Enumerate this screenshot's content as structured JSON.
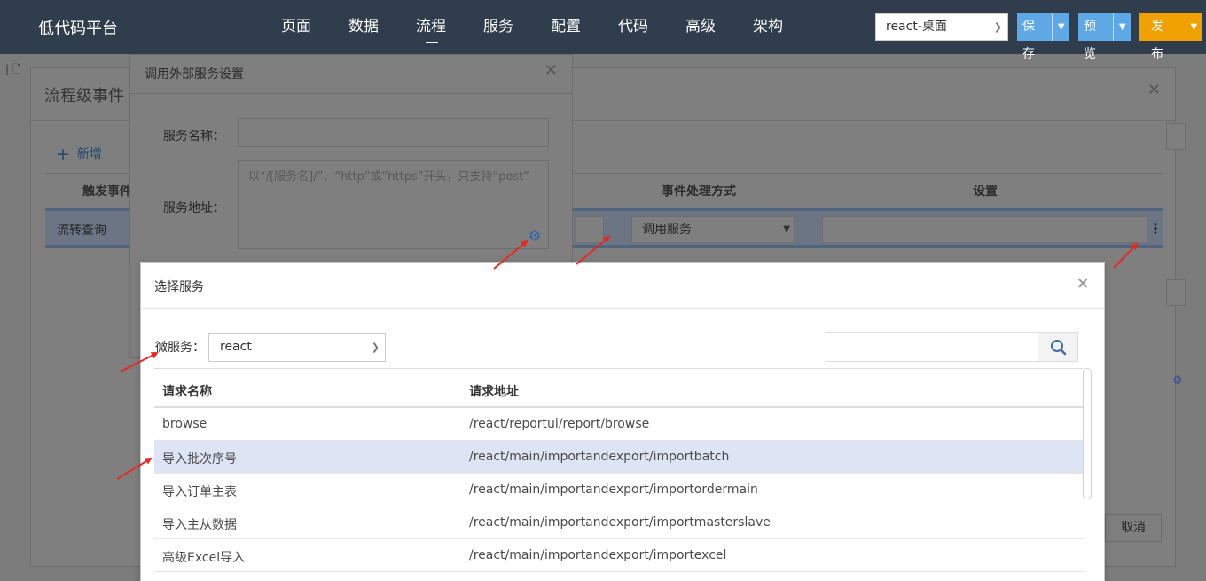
{
  "header": {
    "brand": "低代码平台",
    "nav": [
      "页面",
      "数据",
      "流程",
      "服务",
      "配置",
      "代码",
      "高级",
      "架构"
    ],
    "active_nav": "流程",
    "app_select": "react-桌面",
    "save_label": "保存",
    "preview_label": "预览",
    "publish_label": "发布"
  },
  "flow_dialog": {
    "title": "流程级事件",
    "add_label": "新增",
    "col_trigger": "触发事件",
    "col_method": "事件处理方式",
    "col_settings": "设置",
    "row_trigger": "流转查询",
    "row_method": "调用服务",
    "cancel_label": "取消"
  },
  "ext_dialog": {
    "title": "调用外部服务设置",
    "service_name_label": "服务名称：",
    "service_addr_label": "服务地址：",
    "service_addr_placeholder": "以“/[服务名]/”、“http”或“https”开头，只支持“post”"
  },
  "service_dialog": {
    "title": "选择服务",
    "microservice_label": "微服务：",
    "microservice_value": "react",
    "columns": [
      "请求名称",
      "请求地址"
    ],
    "rows": [
      {
        "name": "browse",
        "url": "/react/reportui/report/browse"
      },
      {
        "name": "导入批次序号",
        "url": "/react/main/importandexport/importbatch"
      },
      {
        "name": "导入订单主表",
        "url": "/react/main/importandexport/importordermain"
      },
      {
        "name": "导入主从数据",
        "url": "/react/main/importandexport/importmasterslave"
      },
      {
        "name": "高级Excel导入",
        "url": "/react/main/importandexport/importexcel"
      }
    ],
    "selected_row": 1
  },
  "colors": {
    "header_bg": "#2f3d4c",
    "button_blue": "#5ea8e6",
    "button_orange": "#f0a000",
    "selected_row": "#dde5f5",
    "arrow_red": "#e8281e"
  }
}
